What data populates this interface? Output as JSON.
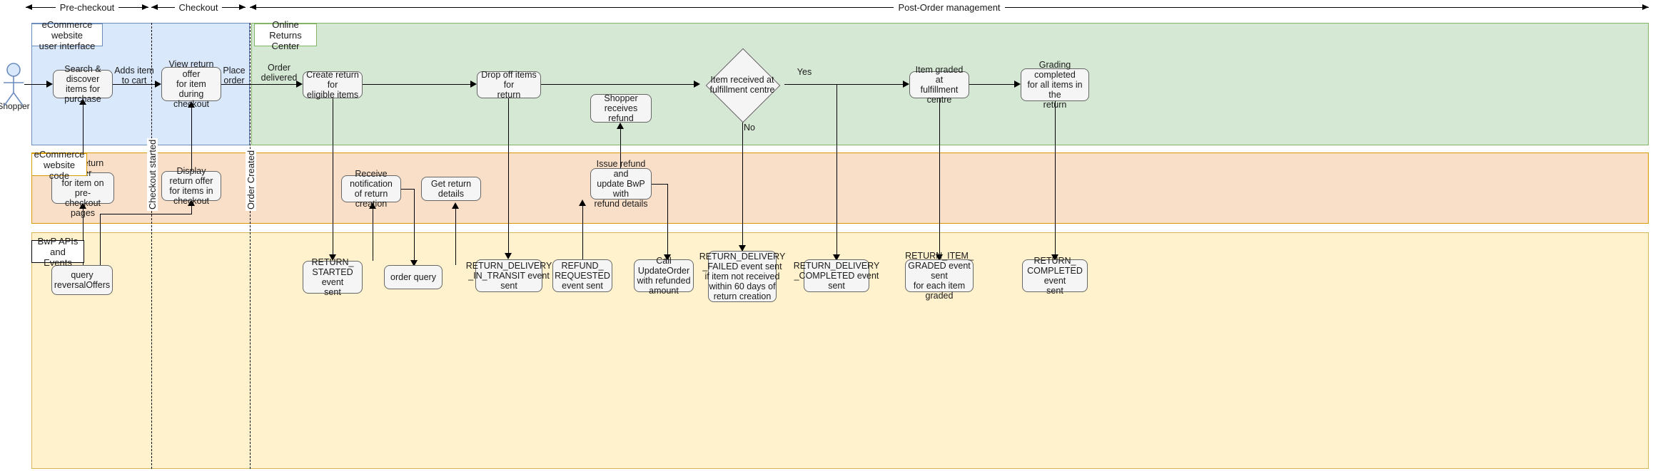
{
  "phases": [
    {
      "label": "Pre-checkout"
    },
    {
      "label": "Checkout"
    },
    {
      "label": "Post-Order management"
    }
  ],
  "lanes": [
    {
      "id": "ui",
      "title": "eCommerce website\nuser interface"
    },
    {
      "id": "green",
      "title": "Online Returns\nCenter"
    },
    {
      "id": "code",
      "title": "eCommerce\nwebsite code"
    },
    {
      "id": "bwp",
      "title": "BwP APIs\nand Events"
    }
  ],
  "actor": {
    "label": "Shopper"
  },
  "milestones": [
    {
      "label": "Checkout started"
    },
    {
      "label": "Order Created"
    }
  ],
  "nodes": {
    "search_discover": "Search & discover\nitems for purchase",
    "view_return_offer": "View return offer\nfor item during\ncheckout",
    "create_return": "Create return for\neligible items",
    "drop_off": "Drop off items for\nreturn",
    "shopper_refund": "Shopper receives\nrefund",
    "item_received": "Item received at\nfulfillment centre",
    "item_graded": "Item graded at\nfulfillment centre",
    "grading_completed": "Grading completed\nfor all items in the\nreturn",
    "add_return_offer": "Add return offer\nfor item on pre-\ncheckout pages",
    "display_offer": "Display return offer\nfor items in checkout",
    "receive_notif": "Receive notification\nof return creation",
    "get_return_details": "Get return details",
    "issue_refund": "Issue refund and\nupdate BwP with\nrefund details",
    "query_reversal": "query\nreversalOffers",
    "ev_return_started": "RETURN_\nSTARTED event\nsent",
    "ev_order_query": "order query",
    "ev_in_transit": "RETURN_DELIVERY\n_IN_TRANSIT event\nsent",
    "ev_refund_req": "REFUND_\nREQUESTED\nevent sent",
    "ev_update_order": "Call UpdateOrder\nwith refunded\namount",
    "ev_delivery_failed": "RETURN_DELIVERY\n_FAILED event sent\nif item not received\nwithin 60 days of\nreturn creation",
    "ev_delivery_done": "RETURN_DELIVERY\n_COMPLETED event\nsent",
    "ev_item_graded": "RETURN_ITEM_\nGRADED event sent\nfor each item graded",
    "ev_return_done": "RETURN_\nCOMPLETED event\nsent"
  },
  "edge_labels": {
    "adds_to_cart": "Adds item\nto cart",
    "place_order": "Place\norder",
    "order_delivered": "Order\ndelivered",
    "yes": "Yes",
    "no": "No"
  },
  "colors": {
    "lane_blue_fill": "#dae8fc",
    "lane_blue_border": "#6c8ebf",
    "lane_green_fill": "#d5e8d4",
    "lane_green_border": "#82b366",
    "lane_orange_fill": "#fadfc8",
    "lane_orange_border": "#d79b00",
    "lane_yellow_fill": "#fff2cc",
    "lane_yellow_border": "#d6b656",
    "node_fill": "#f5f5f5",
    "node_border": "#666666",
    "actor": "#6c8ebf"
  }
}
